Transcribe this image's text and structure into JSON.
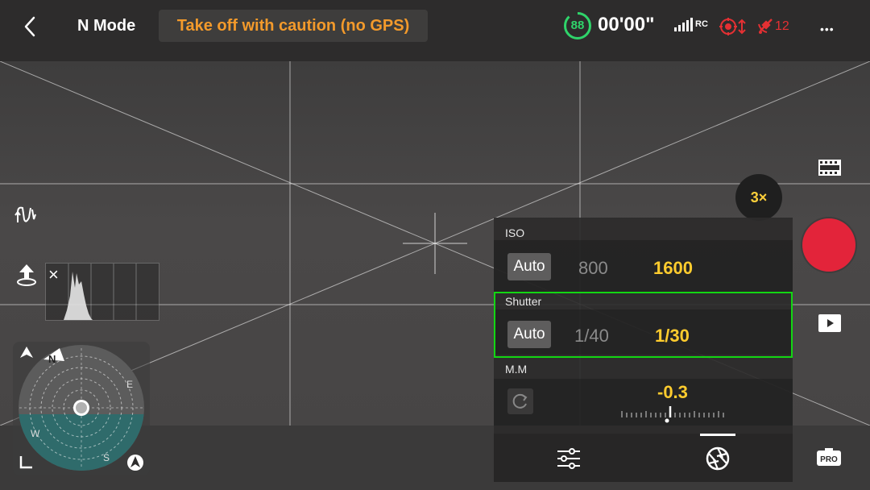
{
  "topbar": {
    "mode": "N Mode",
    "warning": "Take off with caution (no GPS)",
    "battery_percent": "88",
    "flight_time": "00'00\"",
    "rc_label": "RC",
    "satellite_count": "12",
    "more_label": "•••"
  },
  "compass": {
    "north": "N",
    "east": "E",
    "south": "S",
    "west": "W"
  },
  "camera": {
    "zoom": "3×"
  },
  "exposure_panel": {
    "iso": {
      "label": "ISO",
      "auto": "Auto",
      "previous": "800",
      "current": "1600"
    },
    "shutter": {
      "label": "Shutter",
      "auto": "Auto",
      "previous": "1/40",
      "current": "1/30"
    },
    "metering": {
      "label": "M.M",
      "value": "-0.3"
    }
  },
  "bottom_right": {
    "pro_label": "PRO"
  },
  "colors": {
    "warning": "#f39a2b",
    "battery": "#2fd46a",
    "selected_value": "#ffcc2e",
    "record": "#e3243a",
    "highlight": "#13d613",
    "error": "#e43033"
  }
}
